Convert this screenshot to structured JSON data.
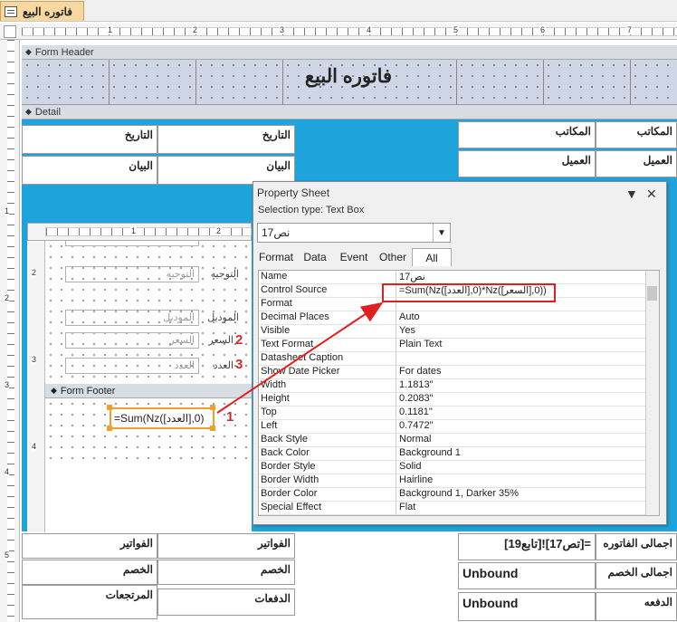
{
  "tab": {
    "title": "فاتوره البيع"
  },
  "ruler": {
    "ticks": [
      "1",
      "2",
      "3",
      "4",
      "5",
      "6",
      "7"
    ],
    "vticks": [
      "1",
      "2",
      "3",
      "4",
      "5"
    ]
  },
  "sections": {
    "header": "Form Header",
    "detail": "Detail"
  },
  "header": {
    "title": "فاتوره البيع"
  },
  "detail": {
    "date_label": "التاريخ",
    "date_field": "التاريخ",
    "desc_label": "البيان",
    "desc_field": "البيان",
    "office_field": "المكاتب",
    "office_label": "المكاتب",
    "client_field": "العميل",
    "client_label": "العميل",
    "invoices_label": "الفواتير",
    "invoices_field": "الفواتير",
    "discount_label": "الخصم",
    "discount_field": "الخصم",
    "returns_label": "المرتجعات",
    "payments_field": "الدفعات",
    "total_field": "=[تص17]![تابع19]",
    "total_label": "اجمالى الفاتوره",
    "unbound1": "Unbound",
    "total_discount_label": "اجمالى الخصم",
    "unbound2": "Unbound",
    "paid_label": "الدفعه"
  },
  "subform": {
    "ruler_ticks": [
      "1",
      "2"
    ],
    "vticks": [
      "2",
      "3",
      "4"
    ],
    "fields": [
      {
        "ghost": "التوجيه",
        "label": "التوجيه"
      },
      {
        "ghost": "الموديل",
        "label": "الموديل"
      },
      {
        "ghost": "السعر",
        "label": "السعر"
      },
      {
        "ghost": "العدد",
        "label": "العدد"
      }
    ],
    "footer_label": "Form Footer",
    "expression": "=Sum(Nz([العدد],0)"
  },
  "annotations": {
    "one": "1",
    "two": "2",
    "three": "3"
  },
  "property_sheet": {
    "title": "Property Sheet",
    "selection": "Selection type:  Text Box",
    "control": "نص17",
    "tabs": [
      "Format",
      "Data",
      "Event",
      "Other",
      "All"
    ],
    "rows": [
      {
        "name": "Name",
        "value": "نص17"
      },
      {
        "name": "Control Source",
        "value": "=Sum(Nz([العدد],0)*Nz([السعر],0))"
      },
      {
        "name": "Format",
        "value": ""
      },
      {
        "name": "Decimal Places",
        "value": "Auto"
      },
      {
        "name": "Visible",
        "value": "Yes"
      },
      {
        "name": "Text Format",
        "value": "Plain Text"
      },
      {
        "name": "Datasheet Caption",
        "value": ""
      },
      {
        "name": "Show Date Picker",
        "value": "For dates"
      },
      {
        "name": "Width",
        "value": "1.1813\""
      },
      {
        "name": "Height",
        "value": "0.2083\""
      },
      {
        "name": "Top",
        "value": "0.1181\""
      },
      {
        "name": "Left",
        "value": "0.7472\""
      },
      {
        "name": "Back Style",
        "value": "Normal"
      },
      {
        "name": "Back Color",
        "value": "Background 1"
      },
      {
        "name": "Border Style",
        "value": "Solid"
      },
      {
        "name": "Border Width",
        "value": "Hairline"
      },
      {
        "name": "Border Color",
        "value": "Background 1, Darker 35%"
      },
      {
        "name": "Special Effect",
        "value": "Flat"
      }
    ]
  },
  "colors": {
    "detail_bg": "#1fa3dc",
    "highlight": "#e02020",
    "selection": "#f0a030",
    "tab": "#f7d9a0"
  }
}
